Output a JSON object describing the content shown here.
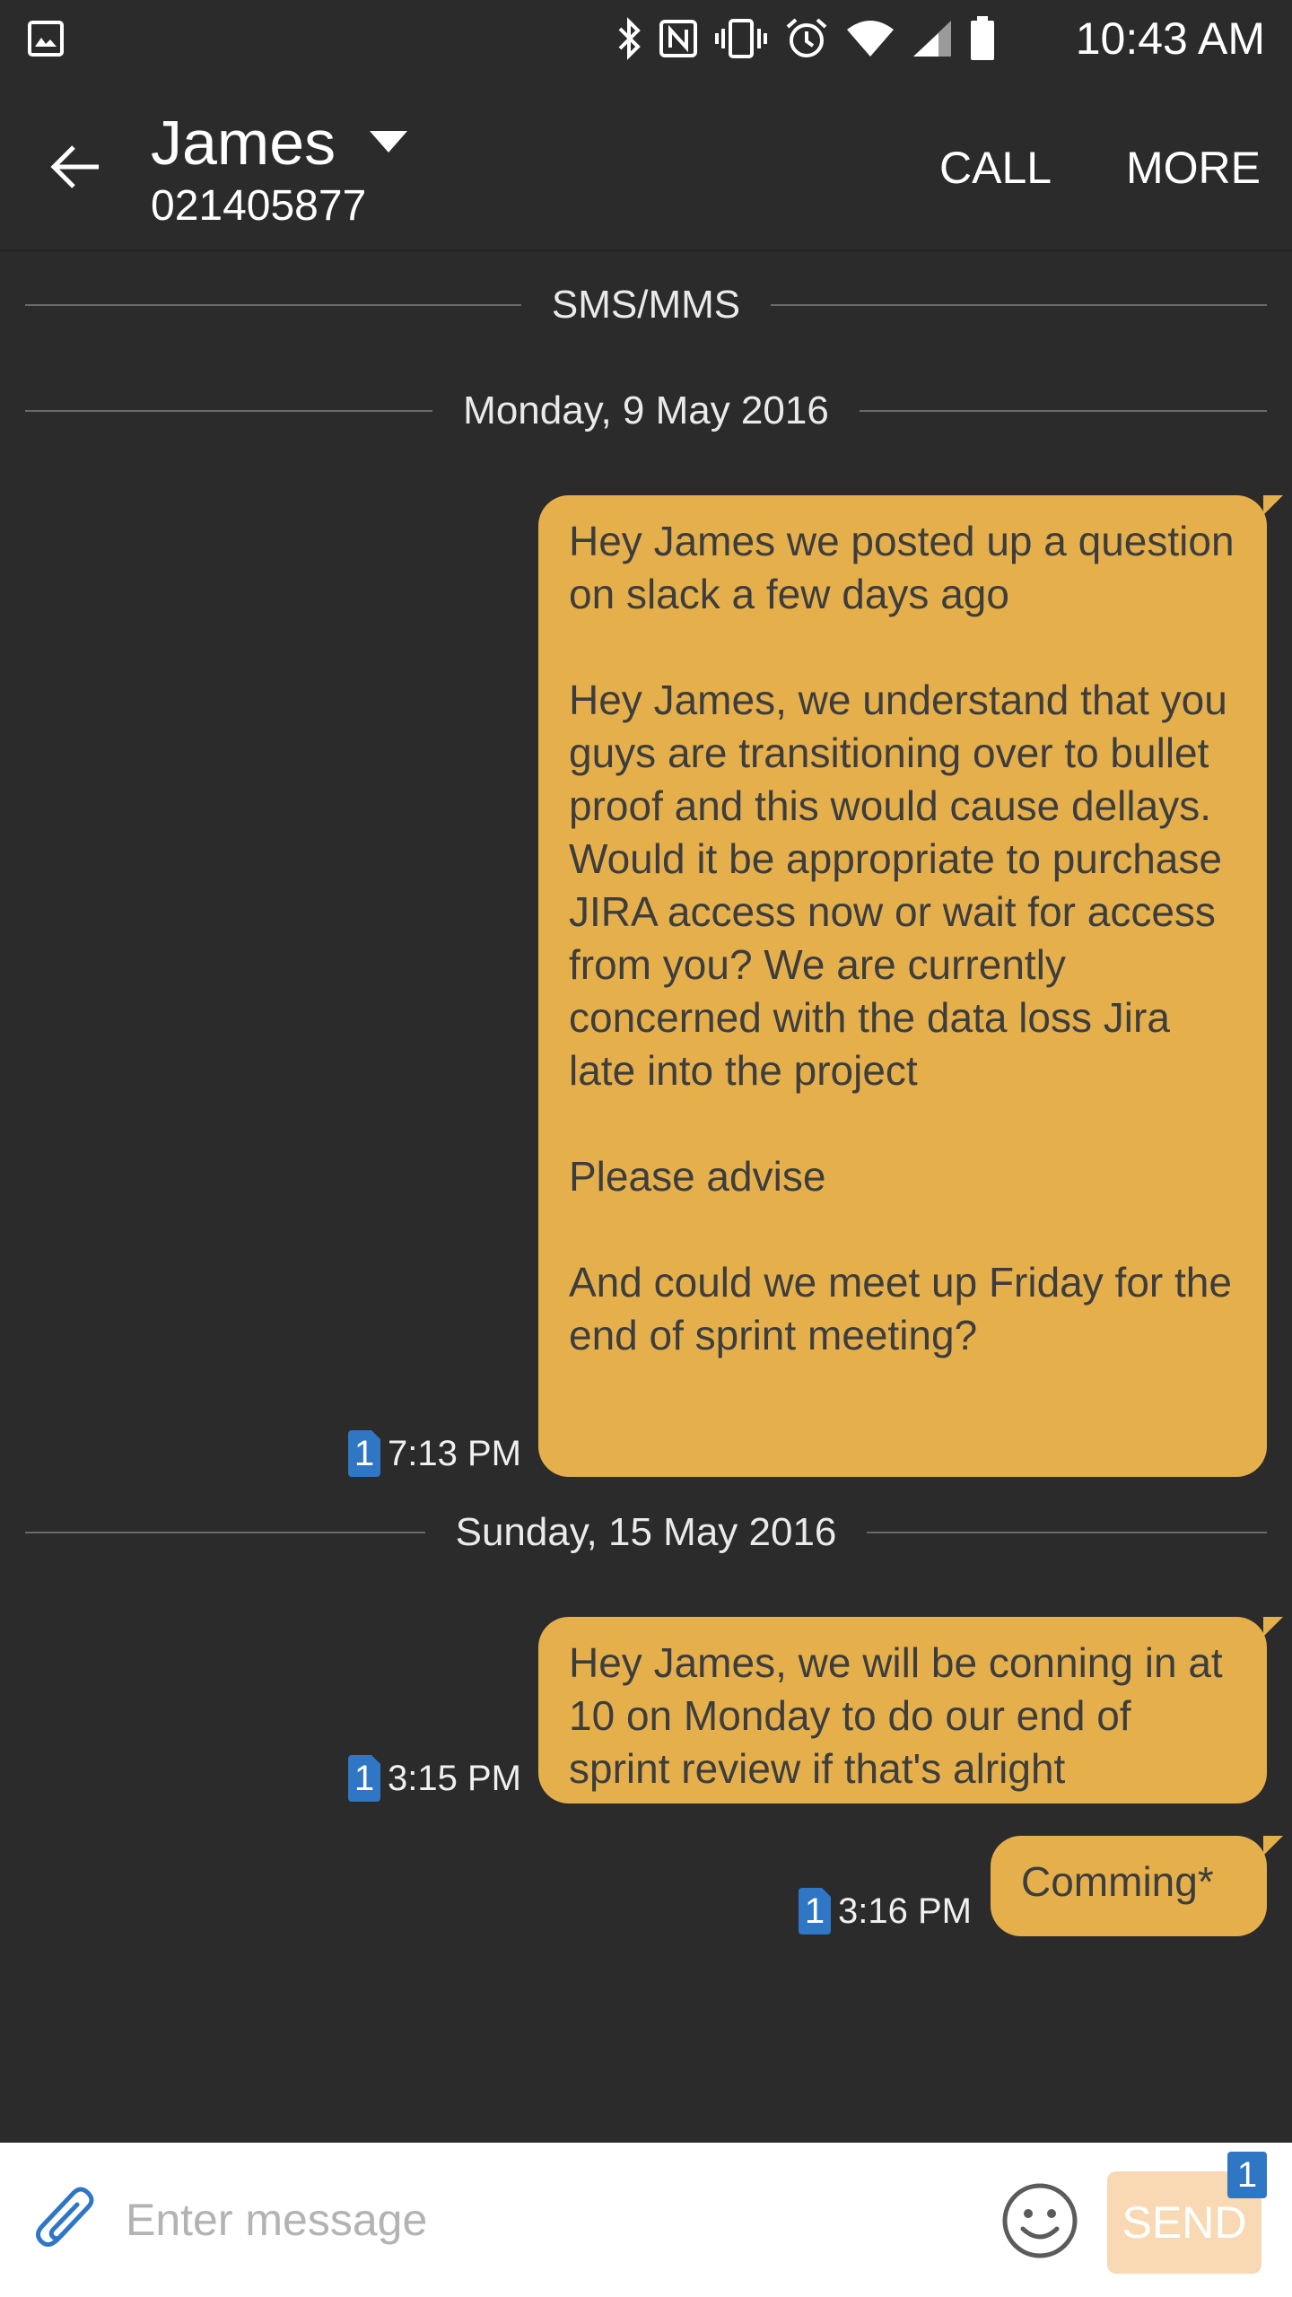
{
  "status_bar": {
    "time": "10:43 AM",
    "icons": [
      "gallery-notification-icon",
      "bluetooth-icon",
      "nfc-icon",
      "vibrate-icon",
      "alarm-icon",
      "wifi-icon",
      "signal-icon",
      "battery-icon"
    ]
  },
  "header": {
    "contact_name": "James",
    "contact_number": "021405877",
    "call_label": "CALL",
    "more_label": "MORE"
  },
  "conversation": {
    "channel_label": "SMS/MMS",
    "groups": [
      {
        "date": "Monday, 9 May 2016",
        "messages": [
          {
            "text": "Hey James we posted up a question on slack a few days ago\n\nHey James, we understand that you guys are transitioning over to bullet proof and this would cause dellays. Would it be appropriate to purchase JIRA access now or wait for access from you? We are currently concerned with the data loss Jira late into the project\n\nPlease advise\n\nAnd could we meet up Friday for the end of sprint meeting?\n",
            "time": "7:13 PM",
            "sim": "1"
          }
        ]
      },
      {
        "date": "Sunday, 15 May 2016",
        "messages": [
          {
            "text": "Hey James, we will be conning in at 10 on Monday to do our end of sprint review if that's alright",
            "time": "3:15 PM",
            "sim": "1"
          },
          {
            "text": "Comming*",
            "time": "3:16 PM",
            "sim": "1"
          }
        ]
      }
    ]
  },
  "compose": {
    "placeholder": "Enter message",
    "send_label": "SEND",
    "sim_badge": "1"
  },
  "colors": {
    "background": "#2b2b2b",
    "bubble": "#e5b04c",
    "sim_badge": "#2f76c5",
    "send_disabled": "#f9d9b3"
  }
}
